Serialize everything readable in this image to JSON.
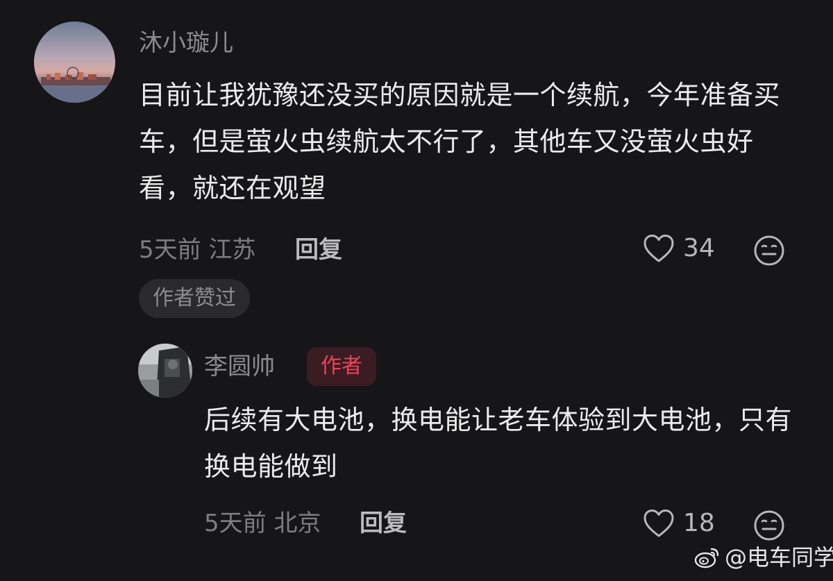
{
  "comments": [
    {
      "username": "沐小璇儿",
      "body": "目前让我犹豫还没买的原因就是一个续航，今年准备买车，但是萤火虫续航太不行了，其他车又没萤火虫好看，就还在观望",
      "time": "5天前",
      "location": "江苏",
      "reply_label": "回复",
      "likes": "34",
      "author_liked_label": "作者赞过"
    },
    {
      "username": "李圆帅",
      "badge": "作者",
      "body": "后续有大电池，换电能让老车体验到大电池，只有换电能做到",
      "time": "5天前",
      "location": "北京",
      "reply_label": "回复",
      "likes": "18"
    }
  ],
  "watermark": {
    "text": "@电车同学",
    "icon": "weibo-icon"
  },
  "colors": {
    "background": "#161618",
    "badge_red": "#f0415a"
  }
}
